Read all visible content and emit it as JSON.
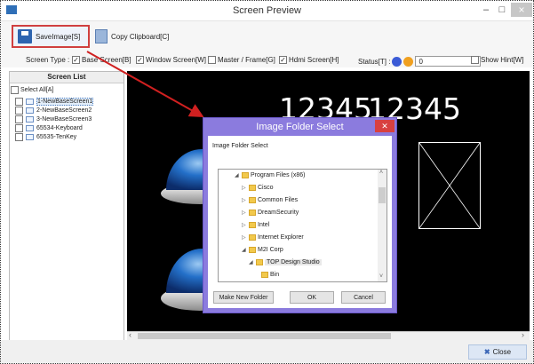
{
  "window": {
    "title": "Screen Preview",
    "minimize": "–",
    "maximize": "□",
    "close": "×"
  },
  "toolbar": {
    "save_label": "SaveImage[S]",
    "copy_label": "Copy Clipboard[C]"
  },
  "options": {
    "screen_type_label": "Screen Type :",
    "base_screen": "Base Screen[B]",
    "window_screen": "Window Screen[W]",
    "master_frame": "Master / Frame[G]",
    "hdmi_screen": "Hdmi Screen[H]",
    "status_label": "Status[T] :",
    "status_value": "0",
    "show_hint": "Show Hint[W]",
    "status_dot_colors": [
      "#3b5bd6",
      "#f0a020"
    ]
  },
  "screen_list": {
    "header": "Screen List",
    "select_all": "Select All[A]",
    "items": [
      "1-NewBaseScreen1",
      "2-NewBaseScreen2",
      "3-NewBaseScreen3",
      "65534-Keyboard",
      "65535-TenKey"
    ]
  },
  "canvas": {
    "text_left": "12345",
    "text_right": "12345"
  },
  "footer": {
    "close_label": "Close"
  },
  "dialog": {
    "title": "Image Folder Select",
    "prompt": "Image Folder Select",
    "folders": [
      "Program Files (x86)",
      "Cisco",
      "Common Files",
      "DreamSecurity",
      "Intel",
      "Internet Explorer",
      "M2I Corp",
      "TOP Design Studio",
      "Bin"
    ],
    "new_folder_label": "Make New Folder",
    "ok_label": "OK",
    "cancel_label": "Cancel"
  }
}
